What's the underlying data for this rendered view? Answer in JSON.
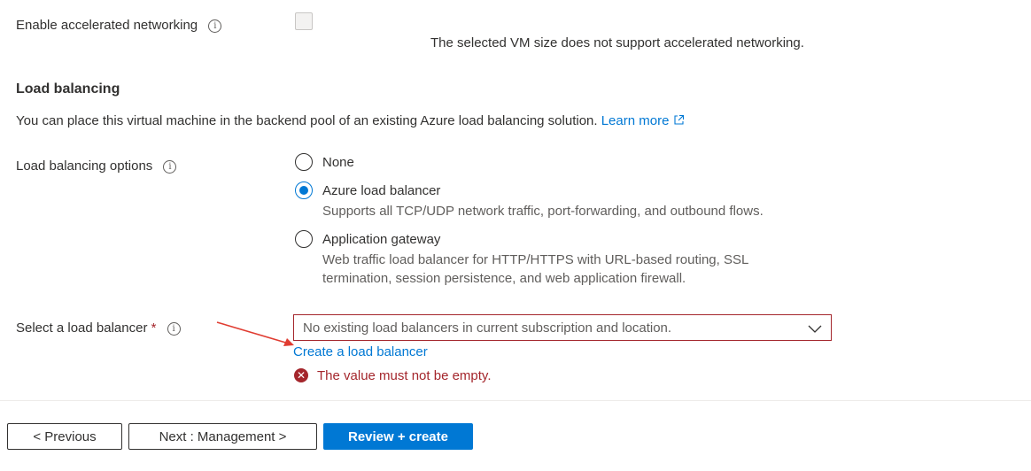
{
  "accelerated_networking": {
    "label": "Enable accelerated networking",
    "info": "i",
    "note": "The selected VM size does not support accelerated networking.",
    "checked": false
  },
  "load_balancing": {
    "title": "Load balancing",
    "description": "You can place this virtual machine in the backend pool of an existing Azure load balancing solution.",
    "learn_more": "Learn more",
    "options_label": "Load balancing options",
    "info": "i",
    "options": [
      {
        "label": "None",
        "sub": "",
        "selected": false
      },
      {
        "label": "Azure load balancer",
        "sub": "Supports all TCP/UDP network traffic, port-forwarding, and outbound flows.",
        "selected": true
      },
      {
        "label": "Application gateway",
        "sub": "Web traffic load balancer for HTTP/HTTPS with URL-based routing, SSL termination, session persistence, and web application firewall.",
        "selected": false
      }
    ]
  },
  "select_lb": {
    "label": "Select a load balancer",
    "required": "*",
    "info": "i",
    "value": "No existing load balancers in current subscription and location.",
    "create_link": "Create a load balancer",
    "error": "The value must not be empty.",
    "error_icon": "✕"
  },
  "footer": {
    "previous": "< Previous",
    "next": "Next : Management >",
    "review": "Review + create"
  },
  "colors": {
    "accent": "#0078d4",
    "error": "#a4262c",
    "annotation_arrow": "#e03c31"
  }
}
